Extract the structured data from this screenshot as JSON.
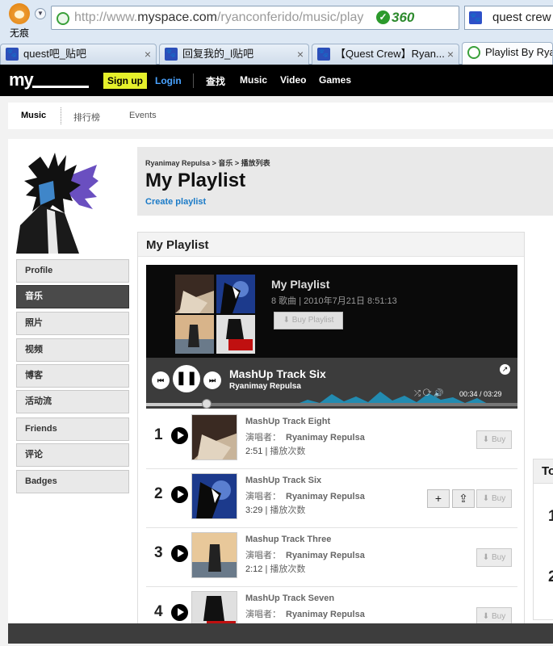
{
  "browser": {
    "wuhen_label": "无痕",
    "url_prefix": "http://www.",
    "url_domain": "myspace.com",
    "url_rest": "/ryanconferido/music/play",
    "security_badge": "360",
    "search_text": "quest crew",
    "tabs": [
      {
        "label": "quest吧_贴吧"
      },
      {
        "label": "回复我的_l贴吧"
      },
      {
        "label": "【Quest Crew】Ryan..."
      },
      {
        "label": "Playlist By Ryanimay"
      }
    ]
  },
  "header": {
    "logo": "my",
    "signup": "Sign up",
    "login": "Login",
    "nav": [
      "查找",
      "Music",
      "Video",
      "Games"
    ]
  },
  "subnav": {
    "items": [
      "Music",
      "排行榜",
      "Events"
    ]
  },
  "sidebar": {
    "items": [
      "Profile",
      "音乐",
      "照片",
      "视频",
      "博客",
      "活动流",
      "Friends",
      "评论",
      "Badges"
    ],
    "active_index": 1
  },
  "page": {
    "breadcrumb_user": "Ryanimay Repulsa",
    "breadcrumb_sep": ">",
    "breadcrumb_music": "音乐",
    "breadcrumb_playlist": "播放列表",
    "title": "My Playlist",
    "create_link": "Create playlist",
    "panel_title": "My Playlist"
  },
  "player": {
    "playlist_name": "My Playlist",
    "playlist_meta": "8 歌曲 | 2010年7月21日 8:51:13",
    "buy_playlist": "Buy Playlist",
    "now_title": "MashUp Track Six",
    "now_artist": "Ryanimay Repulsa",
    "time": "00:34 / 03:29",
    "progress": 0.163
  },
  "tracks": [
    {
      "num": "1",
      "title": "MashUp Track Eight",
      "artist_label": "演唱者：",
      "artist": "Ryanimay Repulsa",
      "duration": "2:51",
      "plays": "播放次数",
      "buy": "Buy"
    },
    {
      "num": "2",
      "title": "MashUp Track Six",
      "artist_label": "演唱者：",
      "artist": "Ryanimay Repulsa",
      "duration": "3:29",
      "plays": "播放次数",
      "buy": "Buy"
    },
    {
      "num": "3",
      "title": "Mashup Track Three",
      "artist_label": "演唱者：",
      "artist": "Ryanimay Repulsa",
      "duration": "2:12",
      "plays": "播放次数",
      "buy": "Buy"
    },
    {
      "num": "4",
      "title": "MashUp Track Seven",
      "artist_label": "演唱者：",
      "artist": "Ryanimay Repulsa",
      "duration": "",
      "plays": "",
      "buy": "Buy"
    }
  ],
  "side_box": {
    "head": "To",
    "ranks": [
      "1",
      "2"
    ]
  },
  "colors": {
    "signup_bg": "#e5f02b",
    "link_blue": "#1a7ac7",
    "header_bg": "#000000"
  }
}
